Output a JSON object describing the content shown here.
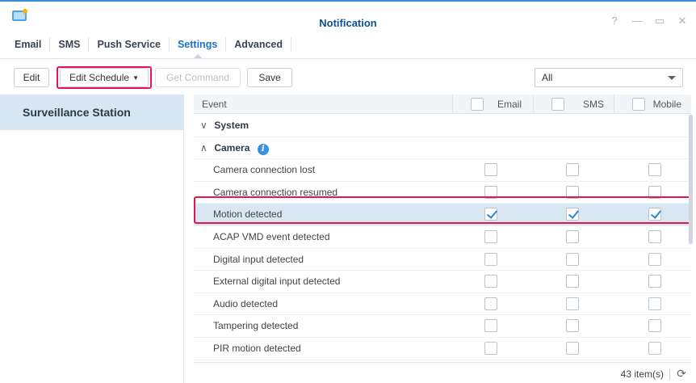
{
  "window": {
    "title": "Notification"
  },
  "tabs": [
    {
      "label": "Email"
    },
    {
      "label": "SMS"
    },
    {
      "label": "Push Service"
    },
    {
      "label": "Settings"
    },
    {
      "label": "Advanced"
    }
  ],
  "toolbar": {
    "edit_label": "Edit",
    "edit_schedule_label": "Edit Schedule",
    "get_command_label": "Get Command",
    "save_label": "Save",
    "filter_value": "All"
  },
  "sidebar": {
    "items": [
      {
        "label": "Surveillance Station"
      }
    ]
  },
  "grid": {
    "columns": {
      "event": "Event",
      "email": "Email",
      "sms": "SMS",
      "mobile": "Mobile"
    },
    "groups": [
      {
        "label": "System",
        "expanded": false
      },
      {
        "label": "Camera",
        "expanded": true
      }
    ],
    "rows": [
      {
        "label": "Camera connection lost",
        "email": false,
        "sms": false,
        "mobile": false
      },
      {
        "label": "Camera connection resumed",
        "email": false,
        "sms": false,
        "mobile": false
      },
      {
        "label": "Motion detected",
        "email": true,
        "sms": true,
        "mobile": true
      },
      {
        "label": "ACAP VMD event detected",
        "email": false,
        "sms": false,
        "mobile": false
      },
      {
        "label": "Digital input detected",
        "email": false,
        "sms": false,
        "mobile": false
      },
      {
        "label": "External digital input detected",
        "email": false,
        "sms": false,
        "mobile": false
      },
      {
        "label": "Audio detected",
        "email": false,
        "sms": false,
        "mobile": false
      },
      {
        "label": "Tampering detected",
        "email": false,
        "sms": false,
        "mobile": false
      },
      {
        "label": "PIR motion detected",
        "email": false,
        "sms": false,
        "mobile": false
      }
    ]
  },
  "footer": {
    "count": "43 item(s)"
  },
  "colors": {
    "accent": "#1f73c5",
    "highlight": "#e0184f",
    "selected_row": "#d9e7f3",
    "sidebar_selected": "#d7e6f2"
  }
}
